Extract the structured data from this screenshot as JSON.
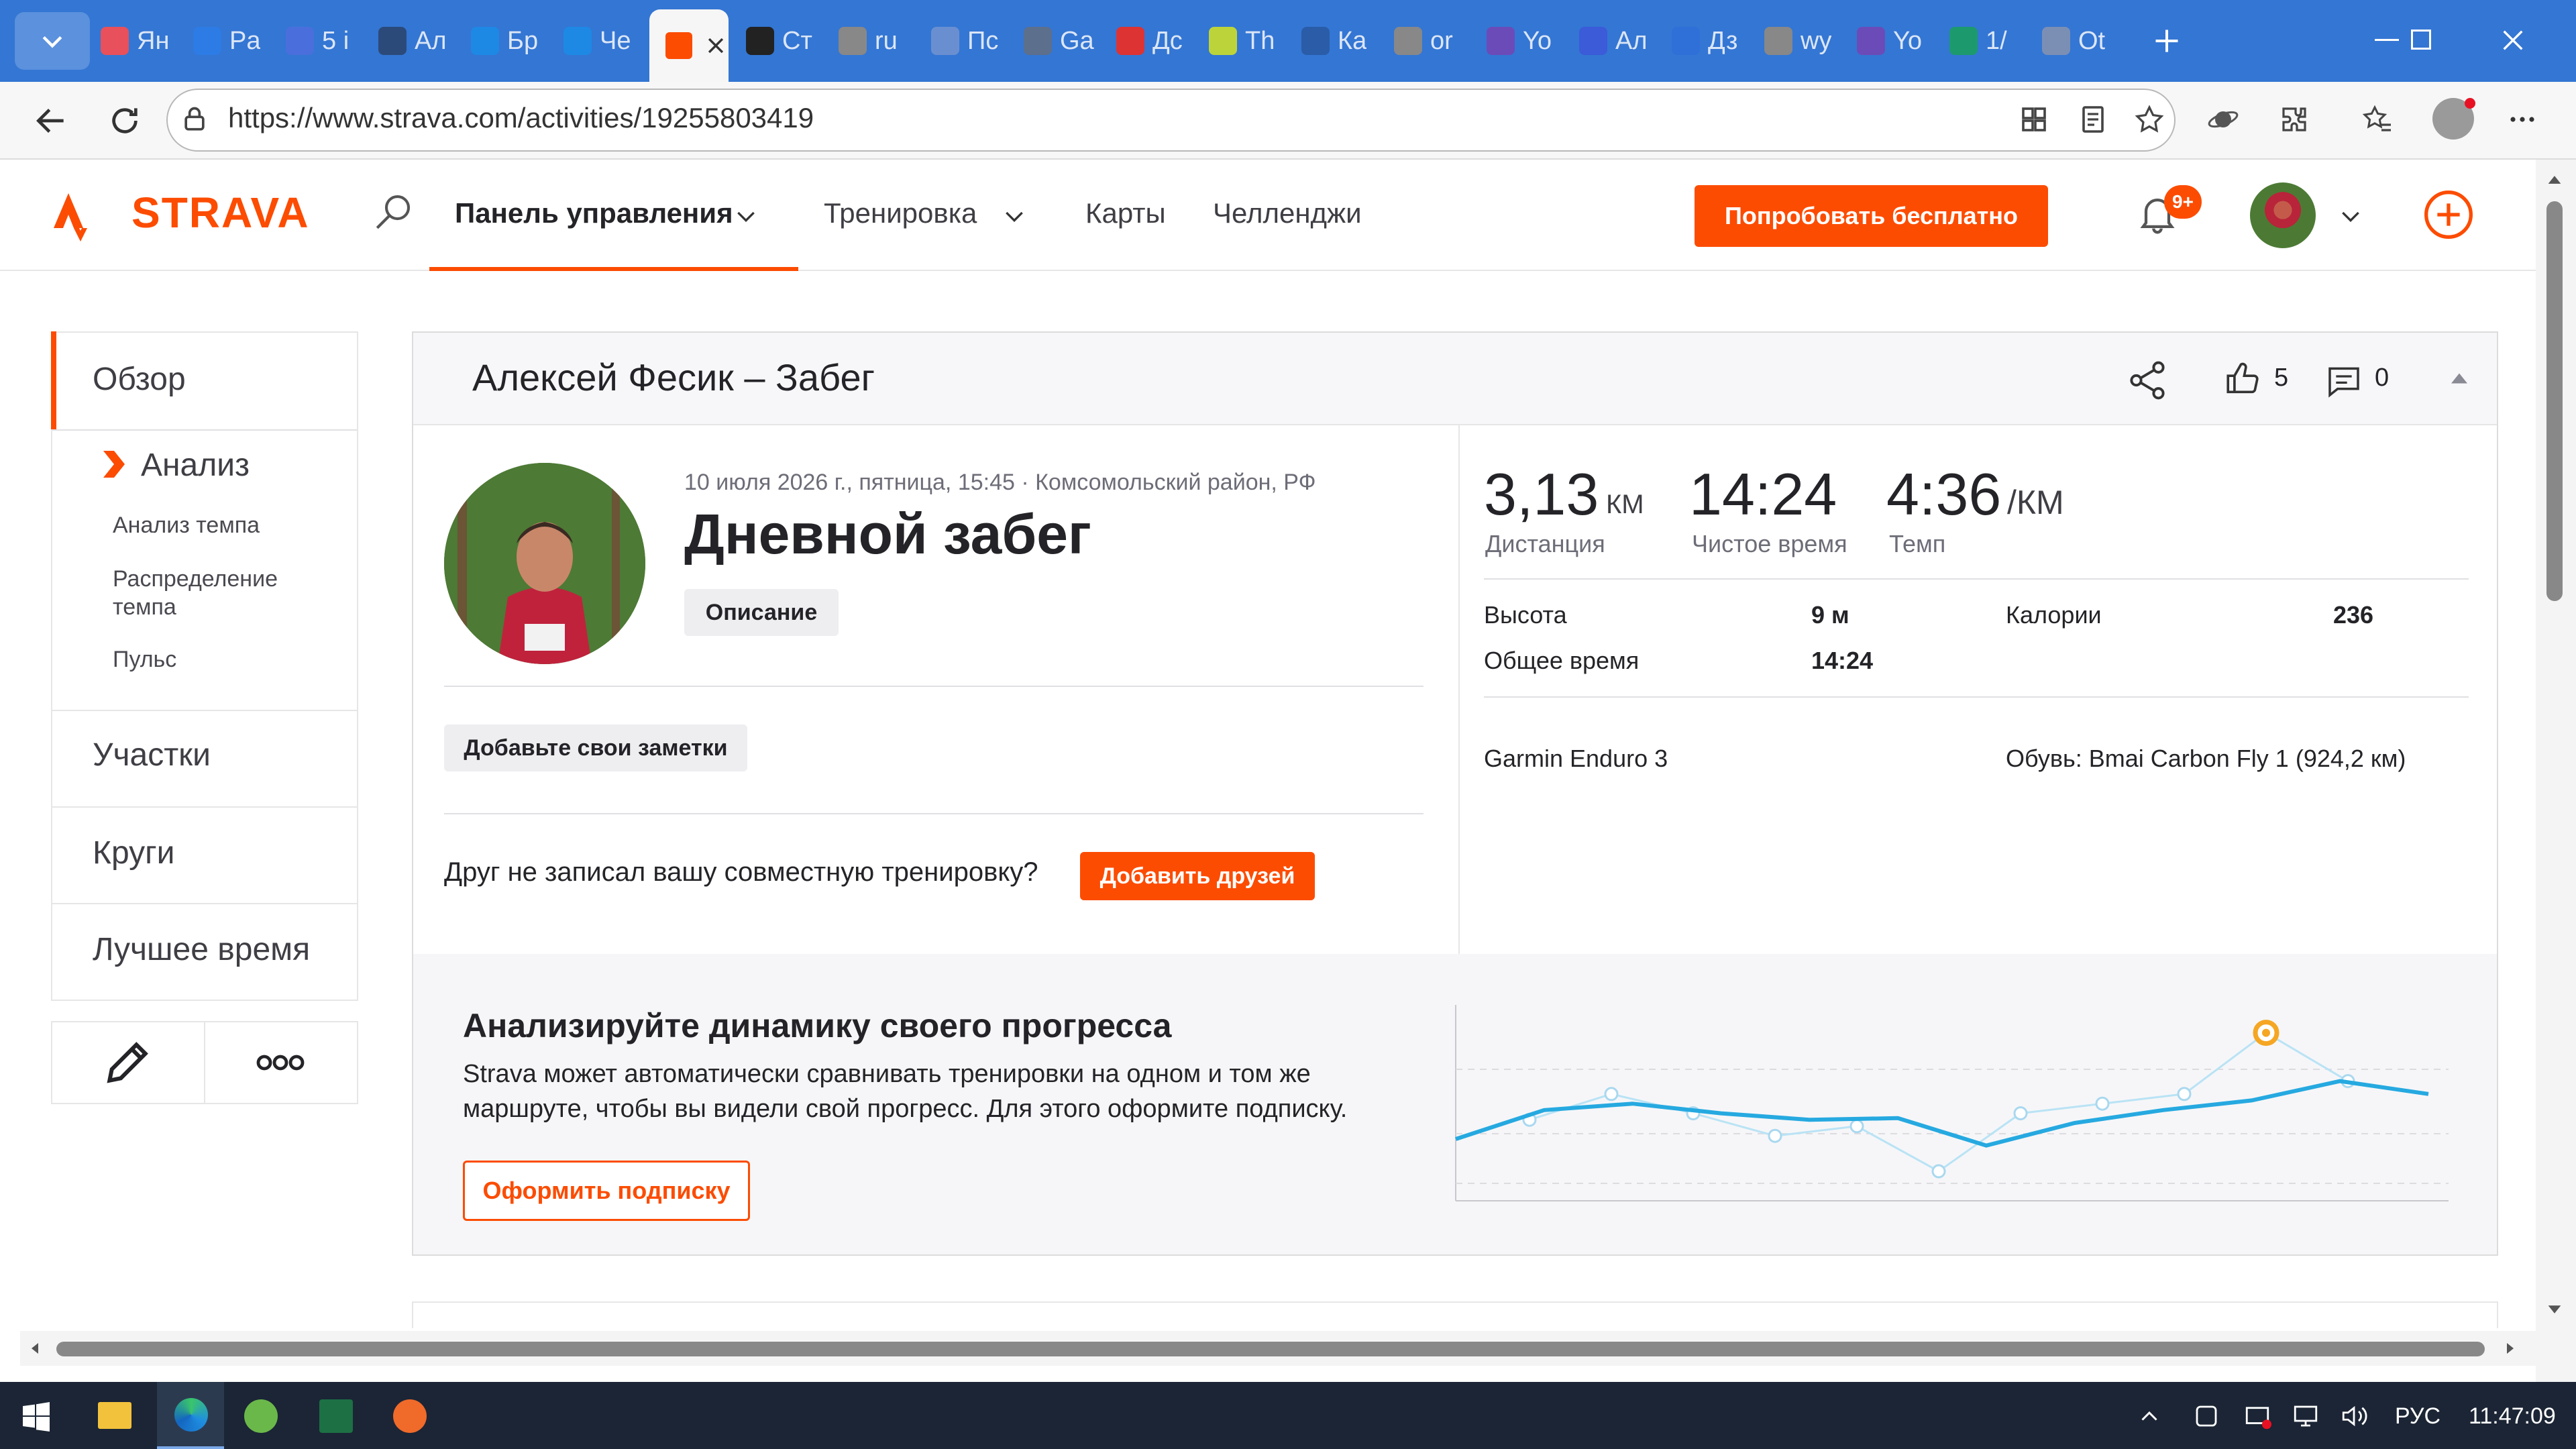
{
  "browser": {
    "tabs": [
      {
        "title": "Ян",
        "icon": "map-pin-icon"
      },
      {
        "title": "Pa",
        "icon": "mail-icon"
      },
      {
        "title": "5 i",
        "icon": "b-logo-icon"
      },
      {
        "title": "Ал",
        "icon": "walker-icon"
      },
      {
        "title": "Бр",
        "icon": "sb-icon"
      },
      {
        "title": "Че",
        "icon": "sb-icon"
      },
      {
        "title": "Ст",
        "icon": "strava-icon"
      },
      {
        "title": "ru",
        "icon": "cross-circle-icon"
      },
      {
        "title": "Пс",
        "icon": "globe-icon"
      },
      {
        "title": "Ga",
        "icon": "triangle-icon"
      },
      {
        "title": "Дс",
        "icon": "flag-icon"
      },
      {
        "title": "Th",
        "icon": "a-logo-icon"
      },
      {
        "title": "Ка",
        "icon": "vk-icon"
      },
      {
        "title": "or",
        "icon": "cross-circle-icon"
      },
      {
        "title": "Yo",
        "icon": "play-icon"
      },
      {
        "title": "Ал",
        "icon": "r-logo-icon"
      },
      {
        "title": "Дз",
        "icon": "sparkle-icon"
      },
      {
        "title": "wy",
        "icon": "cross-circle-icon"
      },
      {
        "title": "Yo",
        "icon": "play-icon"
      },
      {
        "title": "1/",
        "icon": "g-logo-icon"
      },
      {
        "title": "Ot",
        "icon": "check-icon"
      }
    ],
    "url": "https://www.strava.com/activities/19255803419"
  },
  "nav": {
    "logo": "STRAVA",
    "dashboard": "Панель управления",
    "training": "Тренировка",
    "maps": "Карты",
    "challenges": "Челленджи",
    "try_free": "Попробовать бесплатно",
    "notif_badge": "9+"
  },
  "sidebar": {
    "overview": "Обзор",
    "analysis": "Анализ",
    "sub": [
      "Анализ темпа",
      "Распределение темпа",
      "Пульс"
    ],
    "segments": "Участки",
    "laps": "Круги",
    "best": "Лучшее время"
  },
  "activity": {
    "header": "Алексей Фесик – Забег",
    "kudos": "5",
    "comments": "0",
    "meta": "10 июля 2026 г., пятница, 15:45 · Комсомольский район, РФ",
    "title": "Дневной забег",
    "description_btn": "Описание",
    "notes_btn": "Добавьте свои заметки",
    "friend_question": "Друг не записал вашу совместную тренировку?",
    "add_friends_btn": "Добавить друзей",
    "stats": {
      "distance": "3,13",
      "distance_unit": "КМ",
      "distance_label": "Дистанция",
      "moving_time": "14:24",
      "moving_time_label": "Чистое время",
      "pace": "4:36",
      "pace_unit": "/КМ",
      "pace_label": "Темп"
    },
    "details": {
      "elevation_label": "Высота",
      "elevation": "9 м",
      "calories_label": "Калории",
      "calories": "236",
      "elapsed_label": "Общее время",
      "elapsed": "14:24"
    },
    "device": "Garmin Enduro 3",
    "shoes": "Обувь: Bmai Carbon Fly 1 (924,2 км)"
  },
  "promo": {
    "title": "Анализируйте динамику своего прогресса",
    "text_line1": "Strava может автоматически сравнивать тренировки на одном и том же",
    "text_line2": "маршруте, чтобы вы видели свой прогресс. Для этого оформите подписку.",
    "button": "Оформить подписку"
  },
  "chart_data": {
    "type": "line",
    "series": [
      {
        "values": [
          0.3,
          0.48,
          0.52,
          0.46,
          0.42,
          0.43,
          0.26,
          0.4,
          0.48,
          0.54,
          0.66,
          0.58
        ],
        "color": "#26a9e0"
      },
      {
        "values": [
          0.42,
          0.58,
          0.46,
          0.32,
          0.38,
          0.1,
          0.46,
          0.52,
          0.58,
          0.96,
          0.66
        ],
        "color": "#b9e3f5"
      }
    ],
    "highlight": {
      "series": 1,
      "index": 9,
      "color": "#f5a623"
    }
  },
  "taskbar": {
    "lang": "РУС",
    "time": "11:47:09"
  }
}
